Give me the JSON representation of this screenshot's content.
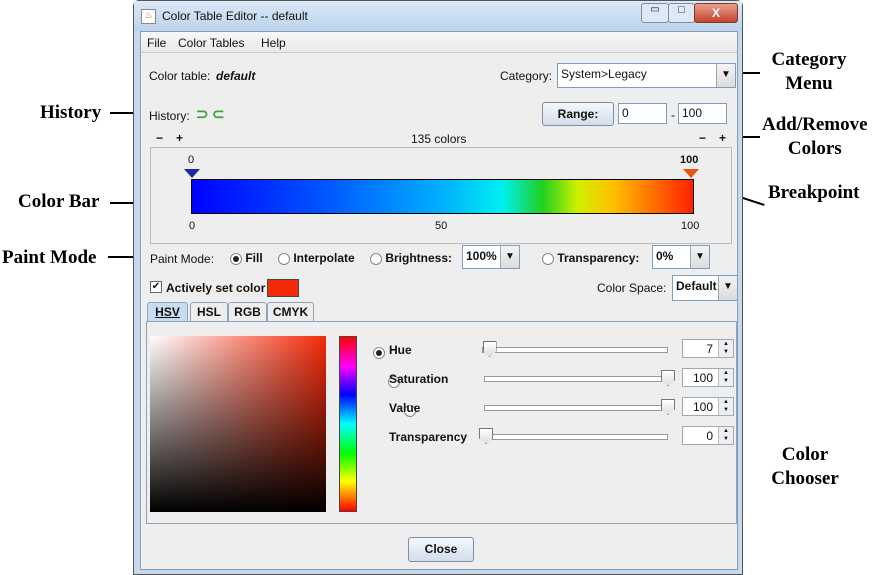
{
  "window": {
    "title": "Color Table Editor -- default",
    "minimize": "▭",
    "maximize": "□",
    "close": "X"
  },
  "menu": [
    "File",
    "Color Tables",
    "Help"
  ],
  "colortable": {
    "label": "Color table:",
    "name": "default"
  },
  "category": {
    "label": "Category:",
    "value": "System>Legacy"
  },
  "history": {
    "label": "History:"
  },
  "range": {
    "button": "Range:",
    "min": "0",
    "sep": "-",
    "max": "100"
  },
  "colors": {
    "count_label": "135 colors",
    "minus": "−",
    "plus": "+"
  },
  "colorbar": {
    "breakpoint_left": "0",
    "breakpoint_right": "100",
    "ticks": [
      "0",
      "50",
      "100"
    ]
  },
  "paint": {
    "label": "Paint Mode:",
    "fill": "Fill",
    "interpolate": "Interpolate",
    "brightness": "Brightness:",
    "brightness_value": "100%",
    "transparency": "Transparency:",
    "transparency_value": "0%",
    "selected": "Fill"
  },
  "active": {
    "label": "Actively set color",
    "checked": true,
    "color": "#f52a0a"
  },
  "colorspace": {
    "label": "Color Space:",
    "value": "Default"
  },
  "tabs": [
    "HSV",
    "HSL",
    "RGB",
    "CMYK"
  ],
  "chooser": {
    "rows": [
      {
        "label": "Hue",
        "value": "7",
        "fraction": 0.02
      },
      {
        "label": "Saturation",
        "value": "100",
        "fraction": 1
      },
      {
        "label": "Value",
        "value": "100",
        "fraction": 1
      },
      {
        "label": "Transparency",
        "value": "0",
        "fraction": 0
      }
    ]
  },
  "close_button": "Close",
  "annotations": {
    "category": "Category\nMenu",
    "history": "History",
    "addremove": "Add/Remove\nColors",
    "colorbar": "Color Bar",
    "breakpoint": "Breakpoint",
    "paintmode": "Paint Mode",
    "chooser": "Color\nChooser"
  }
}
